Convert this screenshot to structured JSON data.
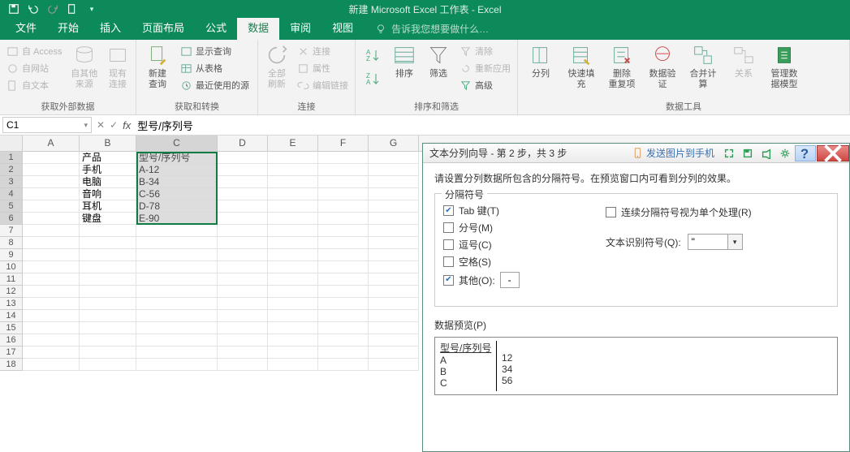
{
  "titlebar": {
    "doc_title": "新建 Microsoft Excel 工作表 - Excel"
  },
  "tabs": {
    "file": "文件",
    "home": "开始",
    "insert": "插入",
    "layout": "页面布局",
    "formulas": "公式",
    "data": "数据",
    "review": "审阅",
    "view": "视图",
    "tellme": "告诉我您想要做什么…"
  },
  "ribbon": {
    "getdata": {
      "access": "自 Access",
      "web": "自网站",
      "text": "自文本",
      "other": "自其他来源",
      "existing": "现有连接",
      "label": "获取外部数据"
    },
    "transform": {
      "newquery": "新建\n查询",
      "show": "显示查询",
      "table": "从表格",
      "recent": "最近使用的源",
      "label": "获取和转换"
    },
    "connections": {
      "refresh": "全部刷新",
      "conn": "连接",
      "props": "属性",
      "edit": "编辑链接",
      "label": "连接"
    },
    "sort": {
      "sort": "排序",
      "filter": "筛选",
      "clear": "清除",
      "reapply": "重新应用",
      "advanced": "高级",
      "label": "排序和筛选"
    },
    "tools": {
      "t2c": "分列",
      "flash": "快速填充",
      "dups": "删除\n重复项",
      "valid": "数据验\n证",
      "consol": "合并计算",
      "rel": "关系",
      "model": "管理数\n据模型",
      "label": "数据工具"
    }
  },
  "namebox": {
    "value": "C1"
  },
  "formula": {
    "value": "型号/序列号"
  },
  "cols": [
    "A",
    "B",
    "C",
    "D",
    "E",
    "F",
    "G"
  ],
  "rowcount": 18,
  "cells": {
    "B1": "产品",
    "C1": "型号/序列号",
    "B2": "手机",
    "C2": "A-12",
    "B3": "电脑",
    "C3": "B-34",
    "B4": "音响",
    "C4": "C-56",
    "B5": "耳机",
    "C5": "D-78",
    "B6": "键盘",
    "C6": "E-90"
  },
  "dialog": {
    "title": "文本分列向导 - 第 2 步，共 3 步",
    "phone": "发送图片到手机",
    "instr": "请设置分列数据所包含的分隔符号。在预览窗口内可看到分列的效果。",
    "legend": "分隔符号",
    "tab": "Tab 键(T)",
    "semi": "分号(M)",
    "comma": "逗号(C)",
    "space": "空格(S)",
    "other": "其他(O):",
    "other_val": "-",
    "consec": "连续分隔符号视为单个处理(R)",
    "textq_label": "文本识别符号(Q):",
    "textq_val": "\"",
    "preview_label": "数据预览(P)",
    "pv_head": "型号/序列号",
    "pv_rows": [
      [
        "A",
        "12"
      ],
      [
        "B",
        "34"
      ],
      [
        "C",
        "56"
      ]
    ]
  }
}
